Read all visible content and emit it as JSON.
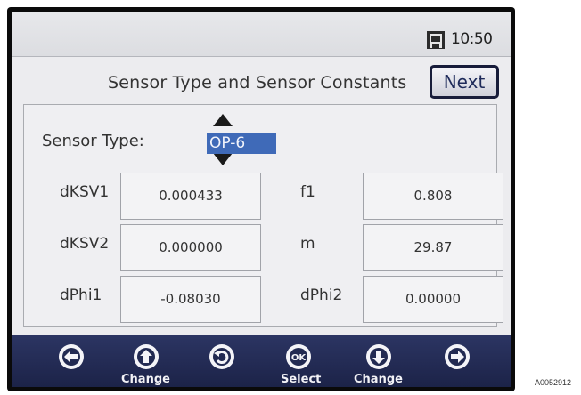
{
  "status": {
    "time": "10:50",
    "device_icon": "device-icon"
  },
  "header": {
    "title": "Sensor Type and Sensor Constants",
    "next_label": "Next"
  },
  "sensor": {
    "label": "Sensor Type:",
    "value": "OP-6"
  },
  "constants": {
    "left": [
      {
        "label": "dKSV1",
        "value": "0.000433"
      },
      {
        "label": "dKSV2",
        "value": "0.000000"
      },
      {
        "label": "dPhi1",
        "value": "-0.08030"
      }
    ],
    "right": [
      {
        "label": "f1",
        "value": "0.808"
      },
      {
        "label": "m",
        "value": "29.87"
      },
      {
        "label": "dPhi2",
        "value": "0.00000"
      }
    ]
  },
  "toolbar": {
    "buttons": [
      {
        "icon": "arrow-left-icon",
        "label": ""
      },
      {
        "icon": "arrow-up-icon",
        "label": "Change"
      },
      {
        "icon": "back-icon",
        "label": ""
      },
      {
        "icon": "ok-icon",
        "label": "Select"
      },
      {
        "icon": "arrow-down-icon",
        "label": "Change"
      },
      {
        "icon": "arrow-right-icon",
        "label": ""
      }
    ]
  },
  "watermark": "A0052912"
}
